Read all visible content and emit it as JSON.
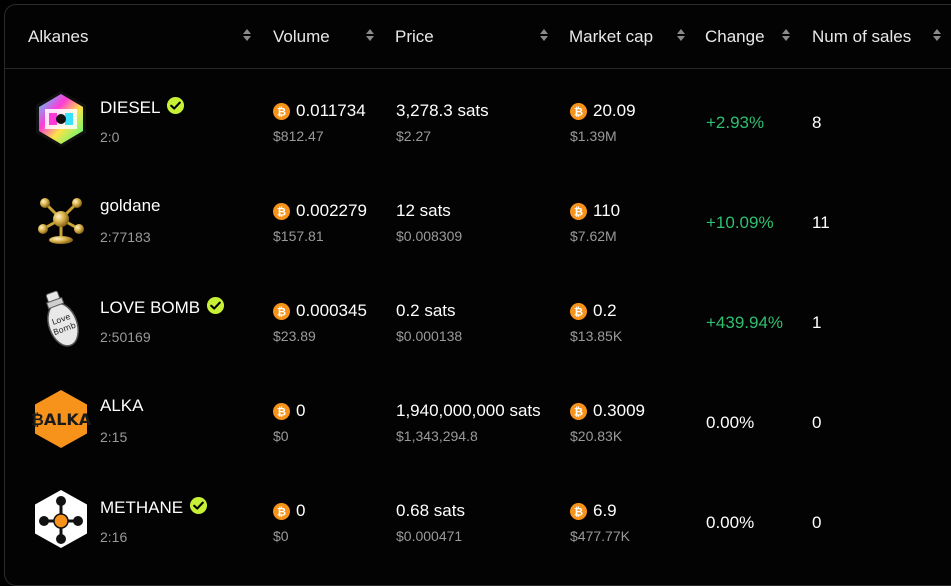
{
  "columns": {
    "alkanes": "Alkanes",
    "volume": "Volume",
    "price": "Price",
    "market_cap": "Market cap",
    "change": "Change",
    "num_sales": "Num of sales"
  },
  "colors": {
    "positive": "#2fbf71",
    "verified": "#c6f135",
    "bitcoin": "#f7931a"
  },
  "rows": [
    {
      "name": "DIESEL",
      "verified": true,
      "id": "2:0",
      "volume_btc": "0.011734",
      "volume_usd": "$812.47",
      "price_sats": "3,278.3 sats",
      "price_usd": "$2.27",
      "mcap_btc": "20.09",
      "mcap_usd": "$1.39M",
      "change": "+2.93%",
      "sales": "8",
      "logo_icon": "diesel-hexagon-logo"
    },
    {
      "name": "goldane",
      "verified": false,
      "id": "2:77183",
      "volume_btc": "0.002279",
      "volume_usd": "$157.81",
      "price_sats": "12 sats",
      "price_usd": "$0.008309",
      "mcap_btc": "110",
      "mcap_usd": "$7.62M",
      "change": "+10.09%",
      "sales": "11",
      "logo_icon": "gold-molecule-logo"
    },
    {
      "name": "LOVE BOMB",
      "verified": true,
      "id": "2:50169",
      "volume_btc": "0.000345",
      "volume_usd": "$23.89",
      "price_sats": "0.2 sats",
      "price_usd": "$0.000138",
      "mcap_btc": "0.2",
      "mcap_usd": "$13.85K",
      "change": "+439.94%",
      "sales": "1",
      "logo_icon": "bomb-logo",
      "logo_text": "Love Bomb"
    },
    {
      "name": "ALKA",
      "verified": false,
      "id": "2:15",
      "volume_btc": "0",
      "volume_usd": "$0",
      "price_sats": "1,940,000,000 sats",
      "price_usd": "$1,343,294.8",
      "mcap_btc": "0.3009",
      "mcap_usd": "$20.83K",
      "change": "0.00%",
      "sales": "0",
      "logo_icon": "alka-logo",
      "logo_text": "₿ALKA"
    },
    {
      "name": "METHANE",
      "verified": true,
      "id": "2:16",
      "volume_btc": "0",
      "volume_usd": "$0",
      "price_sats": "0.68 sats",
      "price_usd": "$0.000471",
      "mcap_btc": "6.9",
      "mcap_usd": "$477.77K",
      "change": "0.00%",
      "sales": "0",
      "logo_icon": "methane-molecule-logo"
    }
  ]
}
